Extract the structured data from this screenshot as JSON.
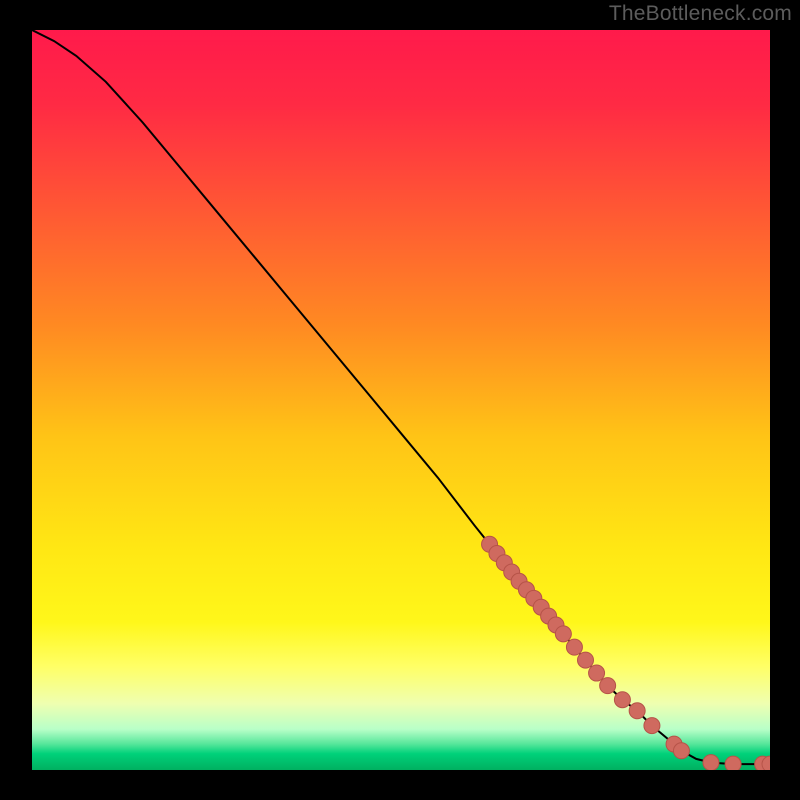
{
  "watermark": "TheBottleneck.com",
  "colors": {
    "gradient_stops": [
      {
        "offset": 0.0,
        "color": "#ff1a4b"
      },
      {
        "offset": 0.1,
        "color": "#ff2a44"
      },
      {
        "offset": 0.25,
        "color": "#ff5a33"
      },
      {
        "offset": 0.4,
        "color": "#ff8a22"
      },
      {
        "offset": 0.55,
        "color": "#ffc416"
      },
      {
        "offset": 0.7,
        "color": "#ffe714"
      },
      {
        "offset": 0.8,
        "color": "#fff71a"
      },
      {
        "offset": 0.86,
        "color": "#ffff66"
      },
      {
        "offset": 0.91,
        "color": "#efffb0"
      },
      {
        "offset": 0.945,
        "color": "#b8ffc8"
      },
      {
        "offset": 0.965,
        "color": "#55e69a"
      },
      {
        "offset": 0.978,
        "color": "#00d17a"
      },
      {
        "offset": 1.0,
        "color": "#00b060"
      }
    ],
    "curve": "#000000",
    "marker_fill": "#cf6a5f",
    "marker_stroke": "#b65348"
  },
  "chart_data": {
    "type": "line",
    "title": "",
    "xlabel": "",
    "ylabel": "",
    "xlim": [
      0,
      100
    ],
    "ylim": [
      0,
      100
    ],
    "grid": false,
    "legend": false,
    "series": [
      {
        "name": "bottleneck-curve",
        "x": [
          0,
          3,
          6,
          10,
          15,
          20,
          25,
          30,
          35,
          40,
          45,
          50,
          55,
          60,
          62,
          64,
          66,
          68,
          70,
          72,
          74,
          76,
          78,
          80,
          82,
          84,
          87,
          88,
          90,
          92,
          95,
          97,
          100
        ],
        "y": [
          100,
          98.5,
          96.5,
          93,
          87.5,
          81.5,
          75.5,
          69.5,
          63.5,
          57.5,
          51.5,
          45.5,
          39.5,
          33.0,
          30.5,
          28.0,
          25.5,
          23.2,
          20.8,
          18.4,
          16.0,
          13.7,
          11.4,
          9.5,
          8.0,
          6.0,
          3.5,
          2.6,
          1.5,
          1.0,
          0.8,
          0.8,
          0.8
        ]
      }
    ],
    "markers": {
      "name": "highlighted-points",
      "points": [
        {
          "x": 62,
          "y": 30.5
        },
        {
          "x": 63,
          "y": 29.25
        },
        {
          "x": 64,
          "y": 28.0
        },
        {
          "x": 65,
          "y": 26.75
        },
        {
          "x": 66,
          "y": 25.5
        },
        {
          "x": 67,
          "y": 24.35
        },
        {
          "x": 68,
          "y": 23.2
        },
        {
          "x": 69,
          "y": 22.0
        },
        {
          "x": 70,
          "y": 20.8
        },
        {
          "x": 71,
          "y": 19.6
        },
        {
          "x": 72,
          "y": 18.4
        },
        {
          "x": 73.5,
          "y": 16.6
        },
        {
          "x": 75,
          "y": 14.85
        },
        {
          "x": 76.5,
          "y": 13.1
        },
        {
          "x": 78,
          "y": 11.4
        },
        {
          "x": 80,
          "y": 9.5
        },
        {
          "x": 82,
          "y": 8.0
        },
        {
          "x": 84,
          "y": 6.0
        },
        {
          "x": 87,
          "y": 3.5
        },
        {
          "x": 88,
          "y": 2.6
        },
        {
          "x": 92,
          "y": 1.0
        },
        {
          "x": 95,
          "y": 0.8
        },
        {
          "x": 99,
          "y": 0.8
        },
        {
          "x": 100,
          "y": 0.8
        }
      ]
    }
  }
}
